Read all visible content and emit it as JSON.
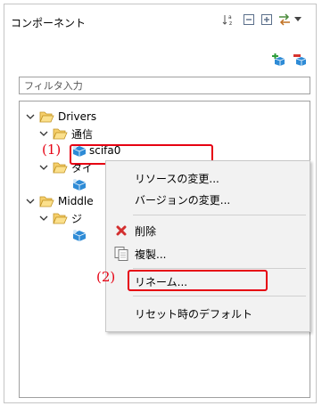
{
  "panel": {
    "title": "コンポーネント"
  },
  "filter": {
    "placeholder": "フィルタ入力"
  },
  "tree": {
    "drivers": "Drivers",
    "tsushin": "通信",
    "scifa0": "scifa0",
    "timer_partial": "タイ",
    "middle_partial": "Middle",
    "ji_partial": "ジ"
  },
  "context_menu": {
    "items": [
      {
        "label": "リソースの変更..."
      },
      {
        "label": "バージョンの変更..."
      },
      {
        "label": "削除"
      },
      {
        "label": "複製..."
      },
      {
        "label": "リネーム..."
      },
      {
        "label": "リセット時のデフォルト"
      }
    ]
  },
  "annotations": {
    "step1": "(1)",
    "step2": "(2)"
  },
  "colors": {
    "annotation": "#e60012",
    "folder": "#e8b64a",
    "component": "#1e88e5",
    "delete": "#d32f2f"
  },
  "icons": {
    "toolbar": [
      "sort-az-icon",
      "collapse-all-icon",
      "expand-all-icon",
      "view-menu-icon",
      "dropdown-arrow-icon"
    ],
    "actions": [
      "add-component-icon",
      "remove-component-icon"
    ]
  }
}
